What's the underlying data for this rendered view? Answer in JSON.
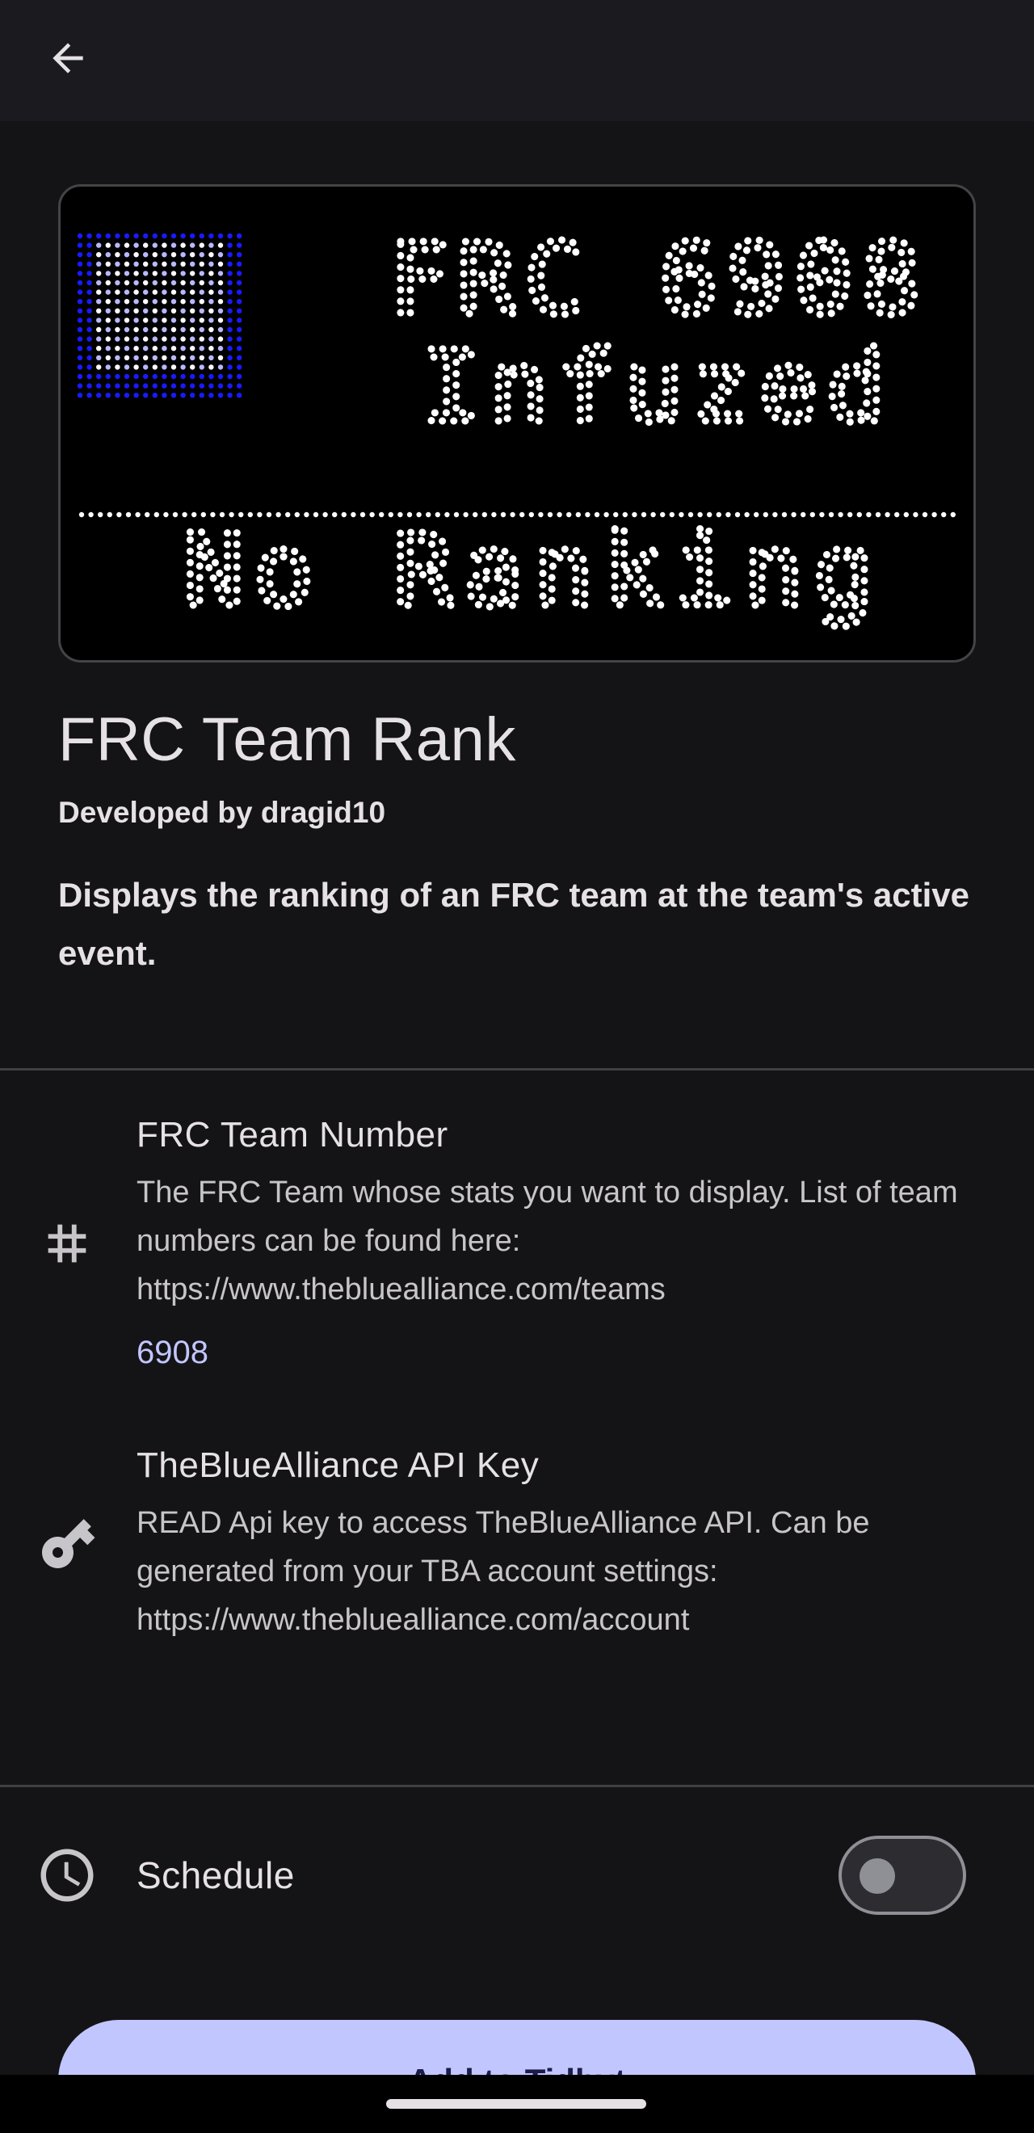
{
  "header": {
    "back_icon": "arrow-back-icon"
  },
  "preview": {
    "line1": "FRC 6908",
    "line2": "Infuzed",
    "line3": "No Ranking",
    "colors": {
      "flag_blue": "#1a1aff",
      "flag_light": "#b8b8ff",
      "dots": "#ffffff"
    }
  },
  "app": {
    "title": "FRC Team Rank",
    "developer": "Developed by dragid10",
    "description": "Displays the ranking of an FRC team at the team's active event."
  },
  "config": [
    {
      "icon": "hash-icon",
      "title": "FRC Team Number",
      "description": "The FRC Team whose stats you want to display. List of team numbers can be found here: https://www.thebluealliance.com/teams",
      "value": "6908"
    },
    {
      "icon": "key-icon",
      "title": "TheBlueAlliance API Key",
      "description": "READ Api key to access TheBlueAlliance API. Can be generated from your TBA account settings: https://www.thebluealliance.com/account"
    }
  ],
  "schedule": {
    "icon": "clock-icon",
    "label": "Schedule",
    "enabled": false
  },
  "add_button": {
    "label": "Add to Tidbyt"
  },
  "colors": {
    "background": "#141416",
    "accent": "#c2c6ff",
    "text": "#e6e1e5",
    "muted": "#c8c5ca"
  }
}
